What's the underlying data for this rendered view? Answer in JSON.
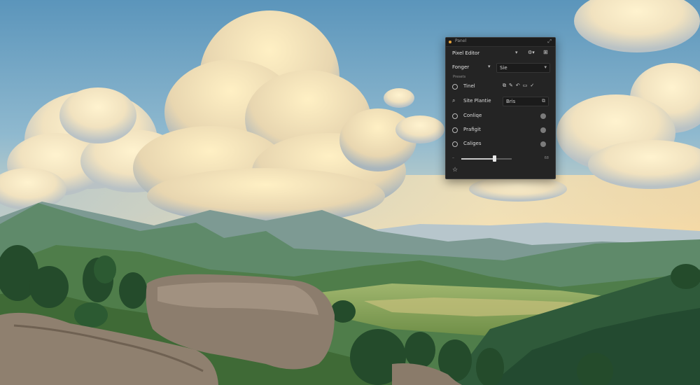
{
  "panel": {
    "window_title": "Panel",
    "preset_label": "Pixel Editor",
    "filter_label": "Fonger",
    "filter_value": "Sie",
    "section_label": "Presets",
    "items": [
      {
        "label": "Tinel",
        "kind": "tools",
        "icon": "circle"
      },
      {
        "label": "Site Plantie",
        "kind": "field",
        "value": "Bris",
        "icon": "search-icon"
      },
      {
        "label": "Conliqe",
        "kind": "toggle",
        "icon": "circle"
      },
      {
        "label": "Prafigit",
        "kind": "toggle",
        "icon": "circle"
      },
      {
        "label": "Caliges",
        "kind": "toggle",
        "icon": "circle"
      }
    ],
    "slider": {
      "value_fraction": 0.65,
      "value_label": "68"
    },
    "colors": {
      "panel_bg": "#242424",
      "text": "#d6d6d6"
    }
  }
}
